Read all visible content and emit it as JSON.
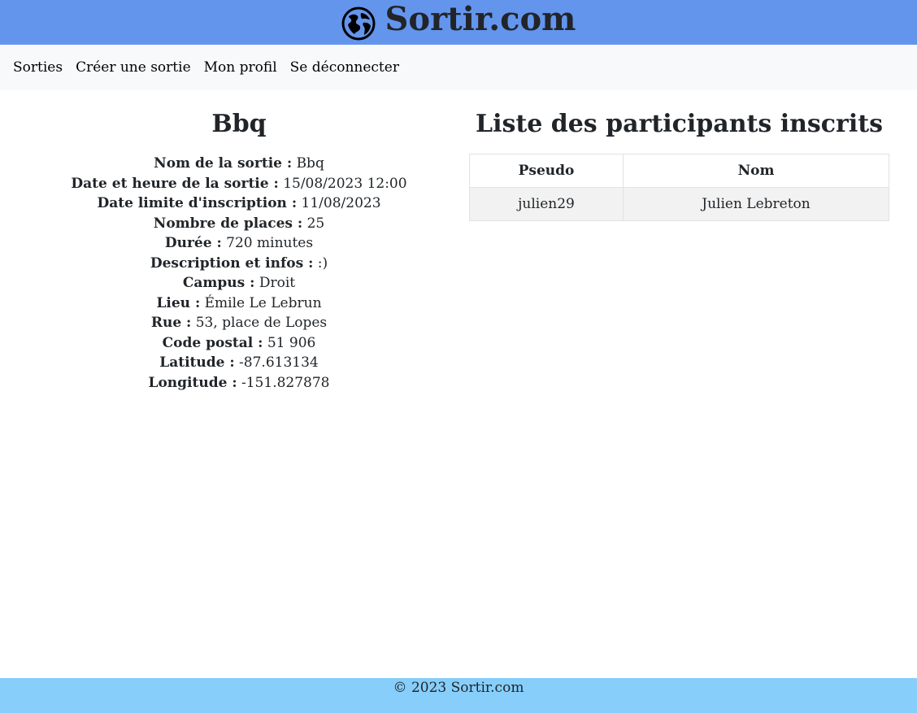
{
  "header": {
    "brand_title": "Sortir.com",
    "brand_icon": "globe-icon",
    "color": "#6495ed"
  },
  "nav": {
    "items": [
      {
        "label": "Sorties"
      },
      {
        "label": "Créer une sortie"
      },
      {
        "label": "Mon profil"
      },
      {
        "label": "Se déconnecter"
      }
    ]
  },
  "outing": {
    "title": "Bbq",
    "fields": [
      {
        "label": "Nom de la sortie :",
        "value": "Bbq"
      },
      {
        "label": "Date et heure de la sortie :",
        "value": "15/08/2023 12:00"
      },
      {
        "label": "Date limite d'inscription :",
        "value": "11/08/2023"
      },
      {
        "label": "Nombre de places :",
        "value": "25"
      },
      {
        "label": "Durée :",
        "value": "720 minutes"
      },
      {
        "label": "Description et infos :",
        "value": ":)"
      },
      {
        "label": "Campus :",
        "value": "Droit"
      },
      {
        "label": "Lieu :",
        "value": "Émile Le Lebrun"
      },
      {
        "label": "Rue :",
        "value": "53, place de Lopes"
      },
      {
        "label": "Code postal :",
        "value": "51 906"
      },
      {
        "label": "Latitude :",
        "value": "-87.613134"
      },
      {
        "label": "Longitude :",
        "value": "-151.827878"
      }
    ]
  },
  "participants": {
    "title": "Liste des participants inscrits",
    "columns": [
      "Pseudo",
      "Nom"
    ],
    "rows": [
      [
        "julien29",
        "Julien Lebreton"
      ]
    ]
  },
  "footer": {
    "text": "© 2023 Sortir.com",
    "color": "#87cefa"
  }
}
